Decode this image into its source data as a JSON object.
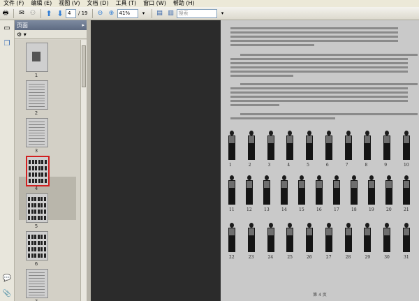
{
  "menu": [
    "文件 (F)",
    "编辑 (E)",
    "视图 (V)",
    "文档 (D)",
    "工具 (T)",
    "窗口 (W)",
    "帮助 (H)"
  ],
  "toolbar": {
    "page_current": "4",
    "page_total": "/ 19",
    "zoom": "41%",
    "search_placeholder": "搜索"
  },
  "panel": {
    "title": "页面",
    "options": "⚙ ▾"
  },
  "thumbnails": [
    {
      "label": "1",
      "kind": "cover"
    },
    {
      "label": "2",
      "kind": "text"
    },
    {
      "label": "3",
      "kind": "text"
    },
    {
      "label": "4",
      "kind": "figures",
      "selected": true
    },
    {
      "label": "5",
      "kind": "figures"
    },
    {
      "label": "6",
      "kind": "figures"
    },
    {
      "label": "7",
      "kind": "text"
    }
  ],
  "document": {
    "figure_rows": [
      [
        "1",
        "2",
        "3",
        "4",
        "5",
        "6",
        "7",
        "8",
        "9",
        "10"
      ],
      [
        "11",
        "12",
        "13",
        "14",
        "15",
        "16",
        "17",
        "18",
        "19",
        "20",
        "21"
      ],
      [
        "22",
        "23",
        "24",
        "25",
        "26",
        "27",
        "28",
        "29",
        "30",
        "31"
      ]
    ],
    "footer": "第 4 页"
  },
  "colors": {
    "viewer_bg": "#2b2b2b",
    "page_bg": "#c9c9c9",
    "selected_border": "#d11f1f"
  }
}
